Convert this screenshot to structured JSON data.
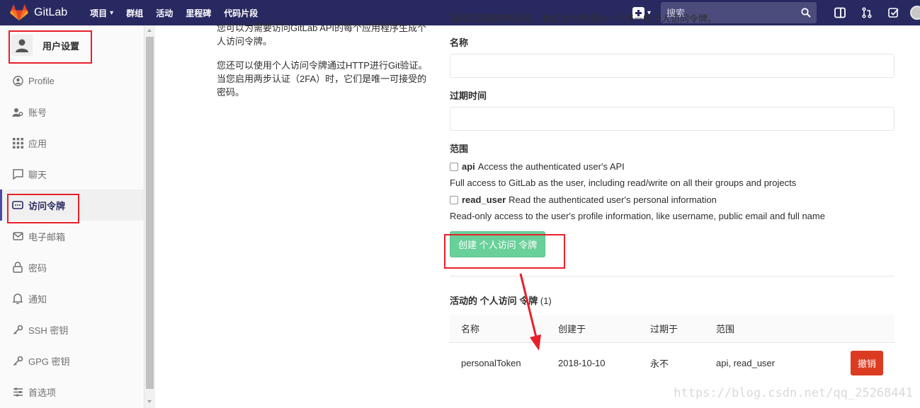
{
  "navbar": {
    "brand": "GitLab",
    "links": [
      "项目",
      "群组",
      "活动",
      "里程碑",
      "代码片段"
    ],
    "search_placeholder": "搜索",
    "icons": [
      "plus-square-icon",
      "search-icon",
      "sidebar-toggle-icon",
      "merge-request-icon",
      "todo-check-icon",
      "user-avatar"
    ]
  },
  "sidebar": {
    "title": "用户设置",
    "items": [
      {
        "label": "Profile",
        "icon": "profile-icon"
      },
      {
        "label": "账号",
        "icon": "account-icon"
      },
      {
        "label": "应用",
        "icon": "applications-icon"
      },
      {
        "label": "聊天",
        "icon": "chat-icon"
      },
      {
        "label": "访问令牌",
        "icon": "token-icon",
        "active": true
      },
      {
        "label": "电子邮箱",
        "icon": "email-icon"
      },
      {
        "label": "密码",
        "icon": "lock-icon"
      },
      {
        "label": "通知",
        "icon": "bell-icon"
      },
      {
        "label": "SSH 密钥",
        "icon": "key-icon"
      },
      {
        "label": "GPG 密钥",
        "icon": "key-icon"
      },
      {
        "label": "首选项",
        "icon": "preferences-icon"
      }
    ]
  },
  "intro": {
    "p1": "您可以为需要访问GitLab API的每个应用程序生成个人访问令牌。",
    "p2": "您还可以使用个人访问令牌通过HTTP进行Git验证。 当您启用两步认证（2FA）时，它们是唯一可接受的密码。"
  },
  "form": {
    "cut_text": "选择应用程序的名称，我们会为您提供一个唯一的个人访问令牌。",
    "name_label": "名称",
    "expires_label": "过期时间",
    "scopes_label": "范围",
    "scopes": [
      {
        "key": "api",
        "title": "Access the authenticated user's API",
        "help": "Full access to GitLab as the user, including read/write on all their groups and projects"
      },
      {
        "key": "read_user",
        "title": "Read the authenticated user's personal information",
        "help": "Read-only access to the user's profile information, like username, public email and full name"
      }
    ],
    "create_button": "创建 个人访问 令牌"
  },
  "active_tokens": {
    "title": "活动的 个人访问 令牌",
    "count": "(1)",
    "headers": [
      "名称",
      "创建于",
      "过期于",
      "范围"
    ],
    "rows": [
      {
        "name": "personalToken",
        "created": "2018-10-10",
        "expires": "永不",
        "scopes": "api, read_user",
        "action": "撤销"
      }
    ]
  },
  "watermark": "https://blog.csdn.net/qq_25268441",
  "colors": {
    "navbar": "#292961",
    "create_button": "#69d09a",
    "revoke_button": "#db3b21",
    "annotation": "#e8202a"
  }
}
